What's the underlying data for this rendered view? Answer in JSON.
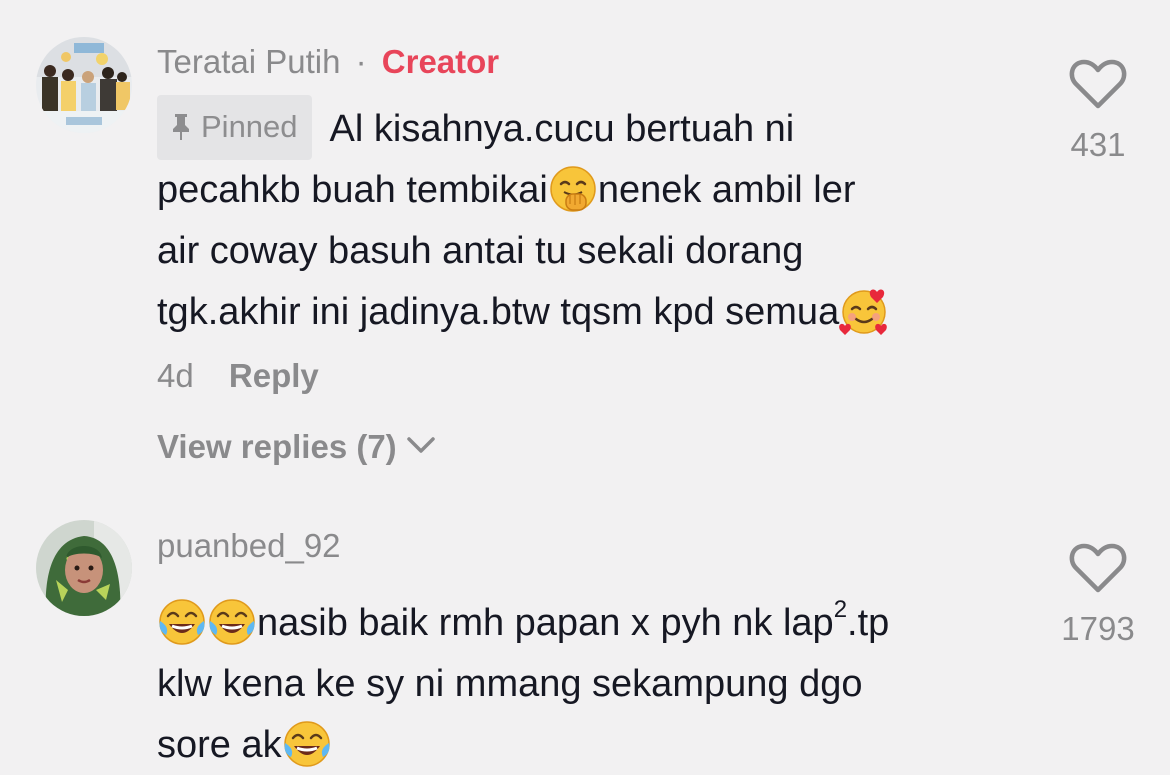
{
  "comments": [
    {
      "author": "Teratai Putih",
      "separator": "·",
      "role": "Creator",
      "pinned_label": "Pinned",
      "text_1": "Al kisahnya.cucu bertuah ni",
      "text_2a": "pecahkb buah tembikai",
      "text_2b": "nenek ambil ler",
      "text_3": "air coway basuh antai tu sekali dorang",
      "text_4": "tgk.akhir ini jadinya.btw tqsm kpd semua",
      "emoji_1": "face-with-hand-over-mouth-icon",
      "emoji_2": "smiling-face-with-hearts-icon",
      "time": "4d",
      "reply_label": "Reply",
      "view_replies": "View replies (7)",
      "likes": "431"
    },
    {
      "author": "puanbed_92",
      "line_1": "nasib baik rmh papan x pyh nk lap",
      "superscript": "2",
      "line_1_end": ".tp",
      "line_2": "klw kena ke sy ni mmang sekampung dgo",
      "line_3": "sore ak",
      "emoji": "face-with-tears-of-joy-icon",
      "likes": "1793"
    }
  ],
  "colors": {
    "background": "#f2f1f2",
    "text": "#161823",
    "muted": "#8a8a8c",
    "creator": "#e8455a"
  }
}
